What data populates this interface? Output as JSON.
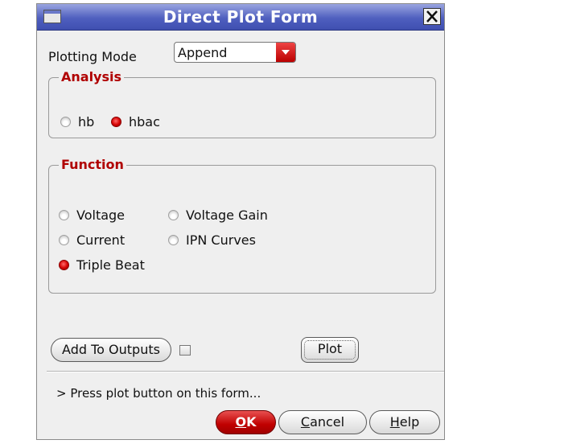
{
  "window": {
    "title": "Direct Plot Form"
  },
  "plotting_mode": {
    "label": "Plotting Mode",
    "value": "Append"
  },
  "analysis": {
    "title": "Analysis",
    "options": [
      {
        "label": "hb",
        "checked": false
      },
      {
        "label": "hbac",
        "checked": true
      }
    ]
  },
  "function": {
    "title": "Function",
    "options": [
      {
        "label": "Voltage",
        "checked": false
      },
      {
        "label": "Voltage Gain",
        "checked": false
      },
      {
        "label": "Current",
        "checked": false
      },
      {
        "label": "IPN Curves",
        "checked": false
      },
      {
        "label": "Triple Beat",
        "checked": true
      }
    ]
  },
  "buttons": {
    "add_to_outputs": "Add To Outputs",
    "plot": "Plot",
    "ok_first": "O",
    "ok_rest": "K",
    "cancel_first": "C",
    "cancel_rest": "ancel",
    "help_first": "H",
    "help_rest": "elp"
  },
  "status": {
    "message": "> Press plot button on this form..."
  },
  "colors": {
    "accent": "#c00000",
    "titlebar": "#4f5fbf"
  }
}
